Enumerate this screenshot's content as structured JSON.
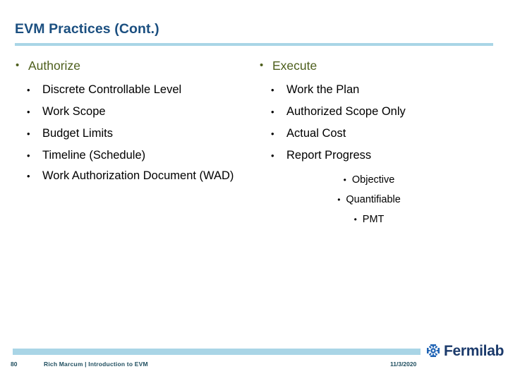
{
  "slide": {
    "title": "EVM Practices (Cont.)",
    "accent_rule_color": "#a9d5e6",
    "title_color": "#1b4f80",
    "level1_color": "#4e5f1d",
    "bullet_glyph": "•"
  },
  "columns": {
    "left": {
      "heading": "Authorize",
      "items": [
        "Discrete Controllable Level",
        "Work Scope",
        "Budget Limits",
        "Timeline (Schedule)",
        "Work Authorization Document (WAD)"
      ]
    },
    "right": {
      "heading": "Execute",
      "items": [
        "Work the Plan",
        "Authorized Scope Only",
        "Actual Cost",
        "Report Progress"
      ],
      "subitems": [
        "Objective",
        "Quantifiable",
        "PMT"
      ]
    }
  },
  "footer": {
    "page_number": "80",
    "author_line": "Rich Marcum | Introduction to EVM",
    "date": "11/3/2020",
    "logo_text": "Fermilab",
    "logo_color": "#1b3a6b",
    "logo_mark_color": "#1f63b4"
  }
}
